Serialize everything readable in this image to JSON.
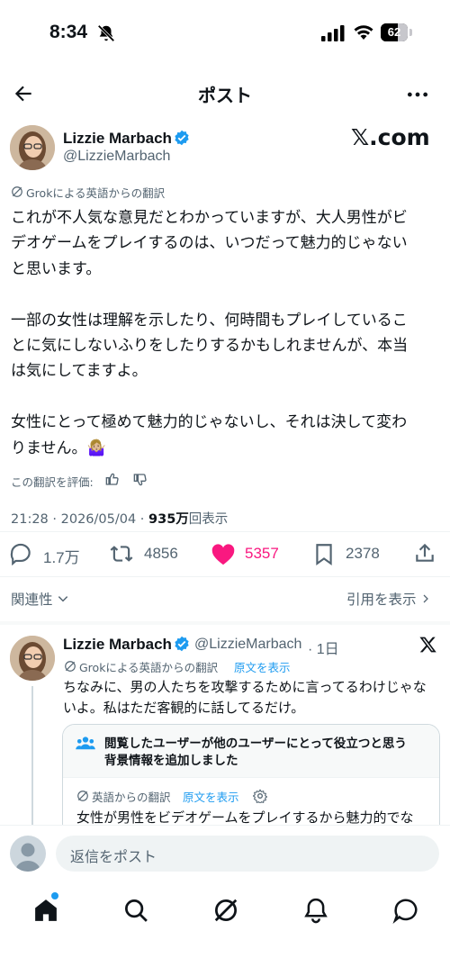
{
  "status": {
    "time": "8:34",
    "battery": "62"
  },
  "nav": {
    "title": "ポスト"
  },
  "post": {
    "author_name": "Lizzie Marbach",
    "author_handle": "@LizzieMarbach",
    "brand": "𝕏.com",
    "translation_label": "Grokによる英語からの翻訳",
    "body_lines": [
      "これが不人気な意見だとわかっていますが、大人男性がビ",
      "デオゲームをプレイするのは、いつだって魅力的じゃない",
      "と思います。",
      "",
      "一部の女性は理解を示したり、何時間もプレイしているこ",
      "とに気にしないふりをしたりするかもしれませんが、本当",
      "は気にしてますよ。",
      "",
      "女性にとって極めて魅力的じゃないし、それは決して変わ",
      "りません。🤷🏼‍♀️"
    ],
    "rate_label": "この翻訳を評価:",
    "meta_time_date": "21:28 · 2026/05/04 · ",
    "meta_views": "935万",
    "meta_views_suffix": "回表示",
    "stats": {
      "replies": "1.7万",
      "reposts": "4856",
      "likes": "5357",
      "bookmarks": "2378"
    }
  },
  "sort": {
    "relevance": "関連性",
    "quotes": "引用を表示"
  },
  "reply": {
    "author_name": "Lizzie Marbach",
    "author_handle": "@LizzieMarbach",
    "time": "· 1日",
    "translation_label": "Grokによる英語からの翻訳",
    "original_link": "原文を表示",
    "body_lines": [
      "ちなみに、男の人たちを攻撃するために言ってるわけじゃな",
      "いよ。私はただ客観的に話してるだけ。"
    ],
    "note_title_lines": [
      "閲覧したユーザーが他のユーザーにとって役立つと思う",
      "背景情報を追加しました"
    ],
    "note_translation_label": "英語からの翻訳",
    "note_original_link": "原文を表示",
    "note_body": "女性が男性をビデオゲームをプレイするから魅力的でな"
  },
  "composer": {
    "placeholder": "返信をポスト"
  },
  "colors": {
    "blue": "#1d9bf0",
    "pink": "#f91880",
    "gray": "#536471"
  }
}
